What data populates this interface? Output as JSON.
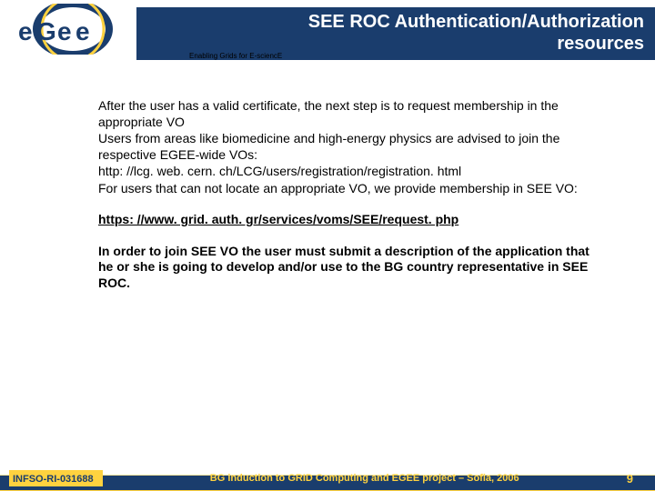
{
  "header": {
    "title_l1": "SEE ROC Authentication/Authorization",
    "title_l2": "resources",
    "tagline": "Enabling Grids for E-sciencE",
    "logo_text": "egee"
  },
  "body": {
    "p1": "After the user has a valid certificate, the next step is to request membership in the appropriate VO",
    "p2": "Users from areas like biomedicine and high-energy physics are advised to join the respective EGEE-wide VOs:",
    "p3": "http: //lcg. web. cern. ch/LCG/users/registration/registration. html",
    "p4": "For users that can not locate an appropriate VO, we provide membership in SEE VO:",
    "link": "https: //www. grid. auth. gr/services/voms/SEE/request. php",
    "instruction": "In order to join SEE VO the user must submit a description of the application that he or she is going to develop and/or use to the BG country representative in SEE ROC."
  },
  "footer": {
    "left": "INFSO-RI-031688",
    "center": "BG induction to GRID Computing and EGEE project – Sofia, 2006",
    "page": "9"
  }
}
